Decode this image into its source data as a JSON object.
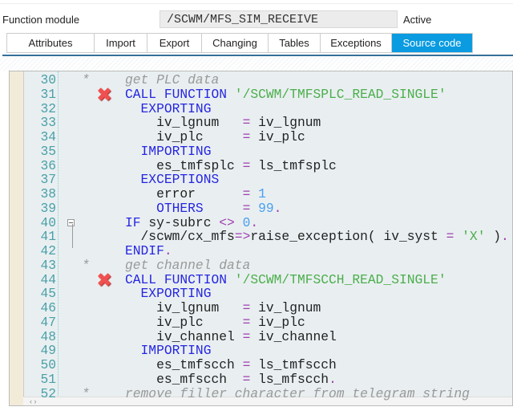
{
  "header": {
    "label": "Function module",
    "value": "/SCWM/MFS_SIM_RECEIVE",
    "status": "Active"
  },
  "tabs": [
    {
      "label": "Attributes",
      "w": 108
    },
    {
      "label": "Import",
      "w": 65
    },
    {
      "label": "Export",
      "w": 67
    },
    {
      "label": "Changing",
      "w": 82
    },
    {
      "label": "Tables",
      "w": 64
    },
    {
      "label": "Exceptions",
      "w": 88
    },
    {
      "label": "Source code",
      "w": 100,
      "active": true
    }
  ],
  "colors": {
    "accent": "#0a9be0",
    "keyword": "#2626e0",
    "string": "#4cae4c",
    "operator": "#a040b0",
    "number": "#4a9ef0",
    "comment": "#999999",
    "error": "#f05050"
  },
  "lines": [
    {
      "n": "30",
      "star": "*",
      "t": [
        [
          "cm",
          "get PLC data"
        ]
      ]
    },
    {
      "n": "31",
      "err": true,
      "t": [
        [
          "kw",
          "CALL FUNCTION "
        ],
        [
          "str",
          "'/SCWM/TMFSPLC_READ_SINGLE'"
        ]
      ]
    },
    {
      "n": "32",
      "t": [
        [
          "kw",
          "  EXPORTING"
        ]
      ]
    },
    {
      "n": "33",
      "t": [
        [
          "id",
          "    iv_lgnum   "
        ],
        [
          "op",
          "="
        ],
        [
          "id",
          " iv_lgnum"
        ]
      ]
    },
    {
      "n": "34",
      "t": [
        [
          "id",
          "    iv_plc     "
        ],
        [
          "op",
          "="
        ],
        [
          "id",
          " iv_plc"
        ]
      ]
    },
    {
      "n": "35",
      "t": [
        [
          "kw",
          "  IMPORTING"
        ]
      ]
    },
    {
      "n": "36",
      "t": [
        [
          "id",
          "    es_tmfsplc "
        ],
        [
          "op",
          "="
        ],
        [
          "id",
          " ls_tmfsplc"
        ]
      ]
    },
    {
      "n": "37",
      "t": [
        [
          "kw",
          "  EXCEPTIONS"
        ]
      ]
    },
    {
      "n": "38",
      "t": [
        [
          "id",
          "    error      "
        ],
        [
          "op",
          "="
        ],
        [
          "num",
          " 1"
        ]
      ]
    },
    {
      "n": "39",
      "t": [
        [
          "kw",
          "    OTHERS     "
        ],
        [
          "op",
          "="
        ],
        [
          "num",
          " 99"
        ],
        [
          "op",
          "."
        ]
      ]
    },
    {
      "n": "40",
      "fold": true,
      "t": [
        [
          "kw",
          "IF "
        ],
        [
          "id",
          "sy-subrc "
        ],
        [
          "op",
          "<>"
        ],
        [
          "num",
          " 0"
        ],
        [
          "op",
          "."
        ]
      ]
    },
    {
      "n": "41",
      "t": [
        [
          "id",
          "  /scwm/cx_mfs"
        ],
        [
          "op",
          "=>"
        ],
        [
          "id",
          "raise_exception( iv_syst "
        ],
        [
          "op",
          "="
        ],
        [
          "str",
          " 'X'"
        ],
        [
          "id",
          " )"
        ],
        [
          "op",
          "."
        ]
      ]
    },
    {
      "n": "42",
      "t": [
        [
          "kw",
          "ENDIF"
        ],
        [
          "op",
          "."
        ]
      ]
    },
    {
      "n": "43",
      "star": "*",
      "t": [
        [
          "cm",
          "get channel data"
        ]
      ]
    },
    {
      "n": "44",
      "err": true,
      "t": [
        [
          "kw",
          "CALL FUNCTION "
        ],
        [
          "str",
          "'/SCWM/TMFSCCH_READ_SINGLE'"
        ]
      ]
    },
    {
      "n": "45",
      "t": [
        [
          "kw",
          "  EXPORTING"
        ]
      ]
    },
    {
      "n": "46",
      "t": [
        [
          "id",
          "    iv_lgnum   "
        ],
        [
          "op",
          "="
        ],
        [
          "id",
          " iv_lgnum"
        ]
      ]
    },
    {
      "n": "47",
      "t": [
        [
          "id",
          "    iv_plc     "
        ],
        [
          "op",
          "="
        ],
        [
          "id",
          " iv_plc"
        ]
      ]
    },
    {
      "n": "48",
      "t": [
        [
          "id",
          "    iv_channel "
        ],
        [
          "op",
          "="
        ],
        [
          "id",
          " iv_channel"
        ]
      ]
    },
    {
      "n": "49",
      "t": [
        [
          "kw",
          "  IMPORTING"
        ]
      ]
    },
    {
      "n": "50",
      "t": [
        [
          "id",
          "    es_tmfscch "
        ],
        [
          "op",
          "="
        ],
        [
          "id",
          " ls_tmfscch"
        ]
      ]
    },
    {
      "n": "51",
      "t": [
        [
          "id",
          "    es_mfscch  "
        ],
        [
          "op",
          "="
        ],
        [
          "id",
          " ls_mfscch"
        ],
        [
          "op",
          "."
        ]
      ]
    },
    {
      "n": "52",
      "star": "*",
      "t": [
        [
          "cm",
          "remove filler character from telegram string"
        ]
      ]
    }
  ],
  "scrollbar": {
    "arrows": "‹ ›"
  }
}
